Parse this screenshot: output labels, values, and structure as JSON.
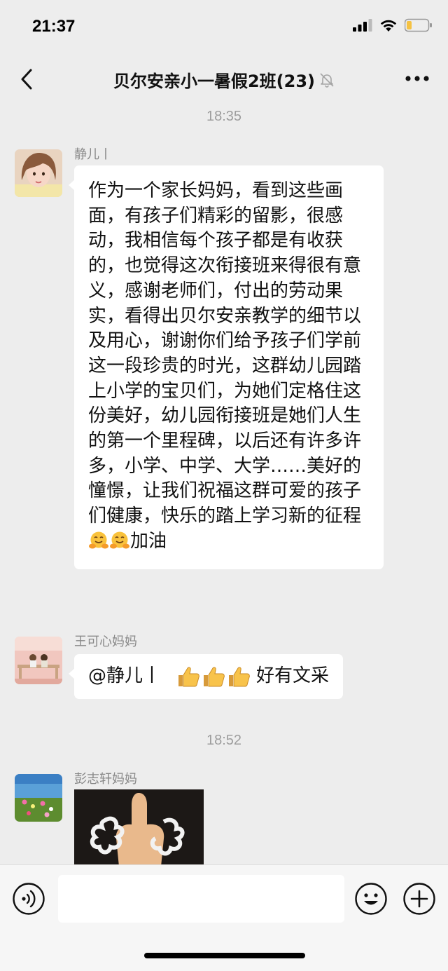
{
  "status": {
    "time": "21:37"
  },
  "header": {
    "title": "贝尔安亲小一暑假2班(23)"
  },
  "messages": {
    "timestamp_1": "18:35",
    "msg1": {
      "sender": "静儿丨",
      "text": "作为一个家长妈妈，看到这些画面，有孩子们精彩的留影，很感动，我相信每个孩子都是有收获的，也觉得这次衔接班来得很有意义，感谢老师们，付出的劳动果实，看得出贝尔安亲教学的细节以及用心，谢谢你们给予孩子们学前这一段珍贵的时光，这群幼儿园踏上小学的宝贝们，为她们定格住这份美好，幼儿园衔接班是她们人生的第一个里程碑，以后还有许多许多，小学、中学、大学……美好的憧憬，让我们祝福这群可爱的孩子们健康，快乐的踏上学习新的征程",
      "text_end": "加油"
    },
    "msg2": {
      "sender": "王可心妈妈",
      "mention": "@静儿丨",
      "text": "好有文采"
    },
    "timestamp_2": "18:52",
    "msg3": {
      "sender": "彭志轩妈妈"
    }
  },
  "icons": {
    "signal": "signal-icon",
    "wifi": "wifi-icon",
    "battery": "battery-icon",
    "back": "chevron-left-icon",
    "mute": "muted-bell-icon",
    "more": "more-dots-icon",
    "voice": "voice-input-icon",
    "emoji": "emoji-smile-icon",
    "plus": "plus-icon",
    "hug_emoji": "hugging-face-emoji",
    "thumbs_emoji": "thumbs-up-emoji"
  },
  "colors": {
    "background": "#ededed",
    "bubble": "#ffffff",
    "battery_fill": "#f5c242"
  }
}
